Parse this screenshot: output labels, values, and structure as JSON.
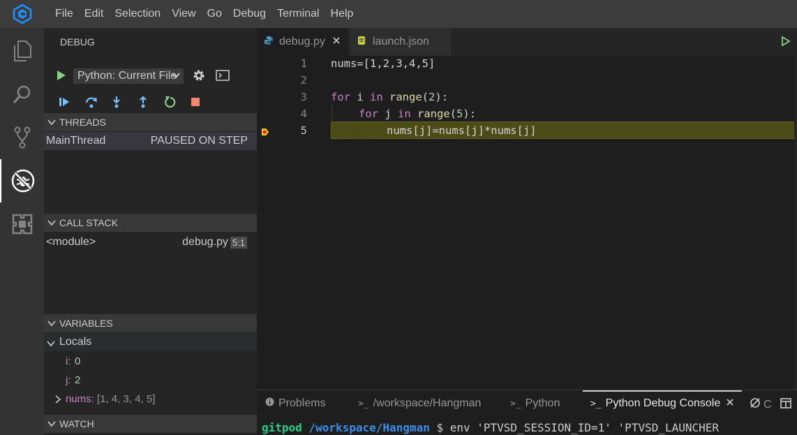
{
  "menu": [
    "File",
    "Edit",
    "Selection",
    "View",
    "Go",
    "Debug",
    "Terminal",
    "Help"
  ],
  "sidebar": {
    "title": "DEBUG",
    "config_label": "Python: Current File",
    "threads": {
      "header": "THREADS",
      "name": "MainThread",
      "status": "PAUSED ON STEP"
    },
    "call_stack": {
      "header": "CALL STACK",
      "frame": "<module>",
      "file": "debug.py",
      "position": "5:1"
    },
    "variables": {
      "header": "VARIABLES",
      "scope": "Locals",
      "vars": [
        {
          "name": "i:",
          "value": "0"
        },
        {
          "name": "j:",
          "value": "2"
        },
        {
          "name": "nums:",
          "value": "[1, 4, 3, 4, 5]"
        }
      ]
    },
    "watch": {
      "header": "WATCH"
    }
  },
  "editor": {
    "tabs": [
      {
        "label": "debug.py"
      },
      {
        "label": "launch.json"
      }
    ],
    "line_numbers": [
      "1",
      "2",
      "3",
      "4",
      "5"
    ],
    "code": {
      "l1": "nums=[1,2,3,4,5]",
      "l3_for": "for",
      "l3_i": " i ",
      "l3_in": "in",
      "l3_range": " range",
      "l3_open": "(",
      "l3_num": "2",
      "l3_close": "):",
      "l4_for": "for",
      "l4_j": " j ",
      "l4_in": "in",
      "l4_range": " range",
      "l4_open": "(",
      "l4_num": "5",
      "l4_close": "):",
      "l5": "nums[j]=nums[j]*nums[j]"
    }
  },
  "panel": {
    "tabs": [
      "Problems",
      "/workspace/Hangman",
      "Python",
      "Python Debug Console"
    ],
    "terminal": {
      "user": "gitpod",
      "path": "/workspace/Hangman",
      "rest": " $ env 'PTVSD_SESSION_ID=1' 'PTVSD_LAUNCHER"
    },
    "extra_label": "C"
  },
  "colors": {
    "accent": "#007acc",
    "run_green": "#89d185",
    "stop_red": "#f48771",
    "debug_blue": "#75beff",
    "current_line": "#4b4b18",
    "terminal_green": "#23d18b",
    "terminal_blue": "#3b8eea"
  }
}
